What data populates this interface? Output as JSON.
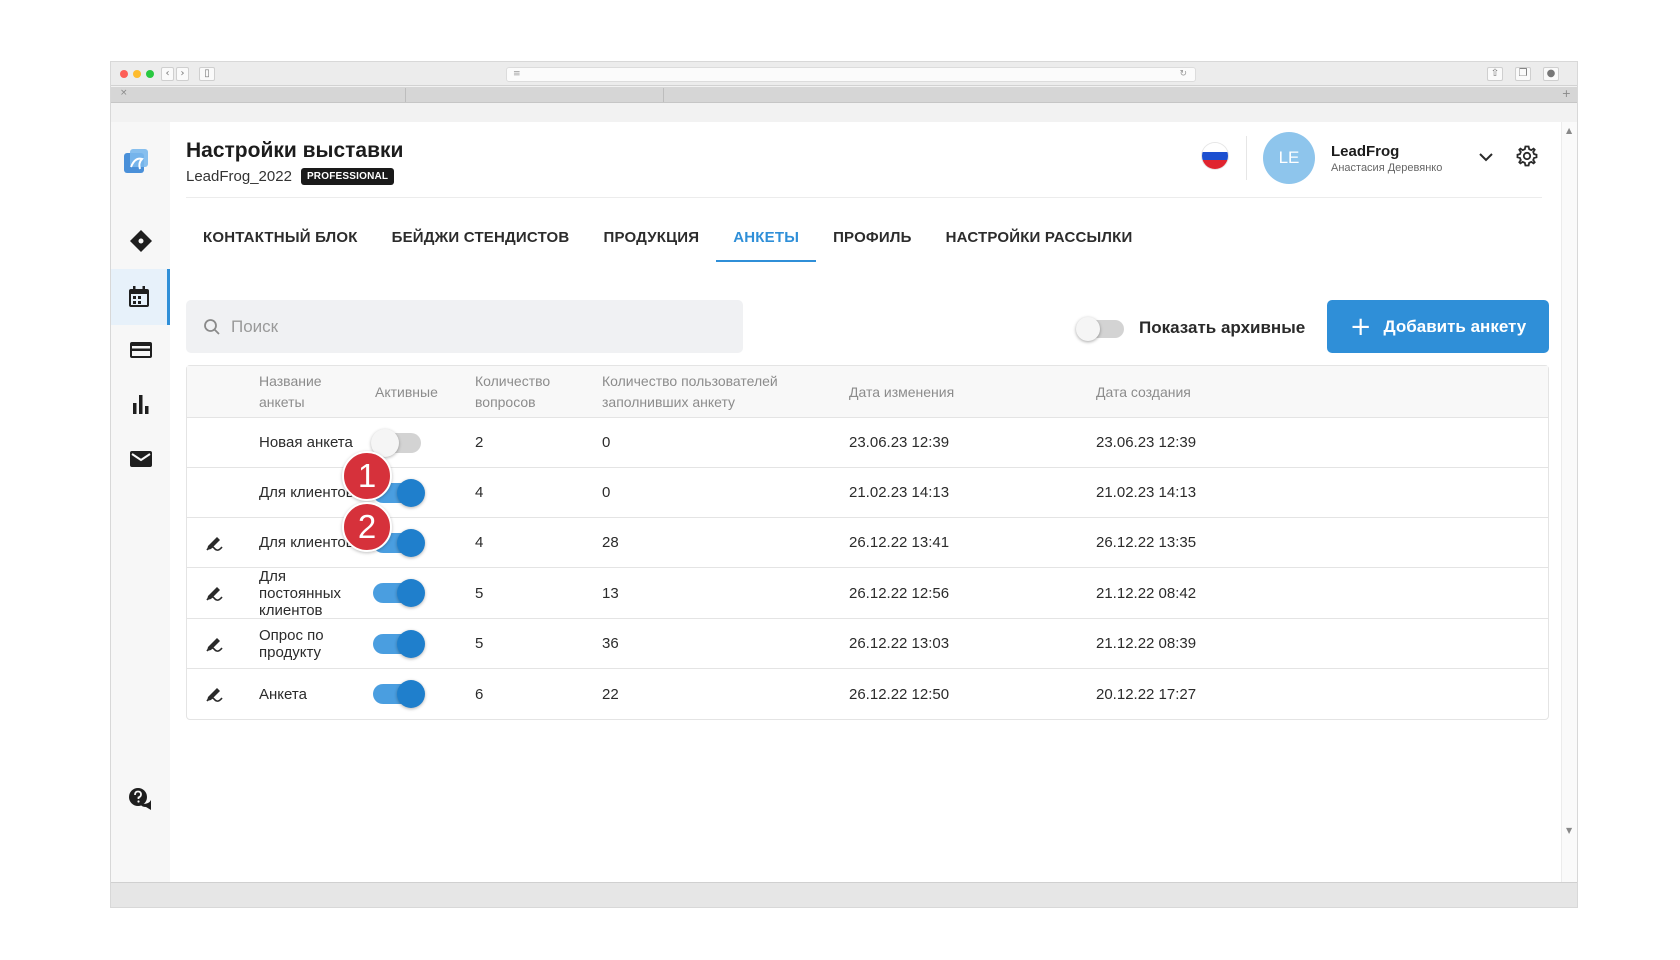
{
  "header": {
    "title": "Настройки выставки",
    "expo_name": "LeadFrog_2022",
    "plan_badge": "PROFESSIONAL",
    "user_initials": "LE",
    "user_name": "LeadFrog",
    "user_subname": "Анастасия Деревянко"
  },
  "tabs": [
    {
      "label": "Контактный блок",
      "active": false
    },
    {
      "label": "Бейджи стендистов",
      "active": false
    },
    {
      "label": "Продукция",
      "active": false
    },
    {
      "label": "Анкеты",
      "active": true
    },
    {
      "label": "Профиль",
      "active": false
    },
    {
      "label": "Настройки рассылки",
      "active": false
    }
  ],
  "toolbar": {
    "search_placeholder": "Поиск",
    "show_archived_label": "Показать архивные",
    "show_archived": false,
    "add_button_label": "Добавить анкету",
    "add_button_icon": "plus-icon"
  },
  "table": {
    "columns": {
      "name": "Название анкеты",
      "active": "Активные",
      "questions": "Количество вопросов",
      "users": "Количество пользователей заполнивших анкету",
      "modified": "Дата изменения",
      "created": "Дата создания"
    },
    "rows": [
      {
        "name": "Новая анкета",
        "active": false,
        "questions": "2",
        "users": "0",
        "modified": "23.06.23 12:39",
        "created": "23.06.23 12:39",
        "icon": ""
      },
      {
        "name": "Для клиентов",
        "active": true,
        "questions": "4",
        "users": "0",
        "modified": "21.02.23 14:13",
        "created": "21.02.23 14:13",
        "icon": ""
      },
      {
        "name": "Для клиентов",
        "active": true,
        "questions": "4",
        "users": "28",
        "modified": "26.12.22 13:41",
        "created": "26.12.22 13:35",
        "icon": "edit-pen-icon"
      },
      {
        "name": "Для постоянных клиентов",
        "active": true,
        "questions": "5",
        "users": "13",
        "modified": "26.12.22 12:56",
        "created": "21.12.22 08:42",
        "icon": "edit-pen-icon"
      },
      {
        "name": "Опрос по продукту",
        "active": true,
        "questions": "5",
        "users": "36",
        "modified": "26.12.22 13:03",
        "created": "21.12.22 08:39",
        "icon": "edit-pen-icon"
      },
      {
        "name": "Анкета",
        "active": true,
        "questions": "6",
        "users": "22",
        "modified": "26.12.22 12:50",
        "created": "20.12.22 17:27",
        "icon": "edit-pen-icon"
      }
    ]
  },
  "markers": [
    "1",
    "2"
  ],
  "sidebar": {
    "icons": [
      "logo-icon",
      "ticket-icon",
      "calendar-icon",
      "card-icon",
      "bar-chart-icon",
      "mail-icon",
      "help-chat-icon"
    ]
  },
  "colors": {
    "accent": "#2f8fd8",
    "marker": "#d6313b",
    "avatar": "#8ec5ec"
  }
}
